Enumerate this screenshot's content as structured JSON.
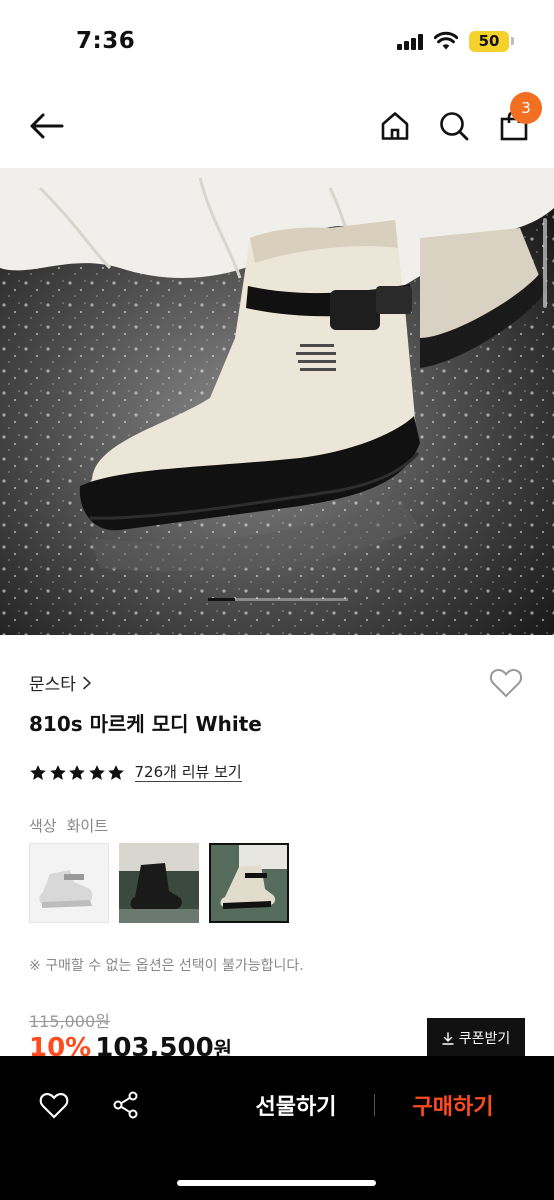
{
  "status_bar": {
    "time": "7:36",
    "battery": "50",
    "icons": [
      "cellular-signal-icon",
      "wifi-icon",
      "battery-icon"
    ]
  },
  "header": {
    "icons": [
      "back-arrow-icon",
      "home-icon",
      "search-icon",
      "shopping-bag-icon"
    ],
    "cart_count": "3"
  },
  "hero": {
    "image": "white ankle rain boot with black sole and black buckle strap on wet glittering ground",
    "pager": {
      "current": 1,
      "total": 5
    }
  },
  "product": {
    "brand": "문스타",
    "title": "810s 마르케 모디 White",
    "rating_stars": 5,
    "review_link": "726개 리뷰 보기"
  },
  "color": {
    "label": "색상",
    "selected": "화이트",
    "swatches": [
      "white boot product shot",
      "black boot lifestyle shot",
      "white boot lifestyle shot"
    ]
  },
  "notice": "※ 구매할 수 없는 옵션은 선택이 불가능합니다.",
  "price": {
    "original": "115,000원",
    "discount": "10%",
    "sale": "103,500",
    "currency": "원",
    "coupon_label": "쿠폰받기"
  },
  "bottom_bar": {
    "gift_label": "선물하기",
    "buy_label": "구매하기"
  },
  "colors": {
    "accent": "#ff4b1f",
    "badge": "#f36f21",
    "battery": "#f5d22b"
  }
}
